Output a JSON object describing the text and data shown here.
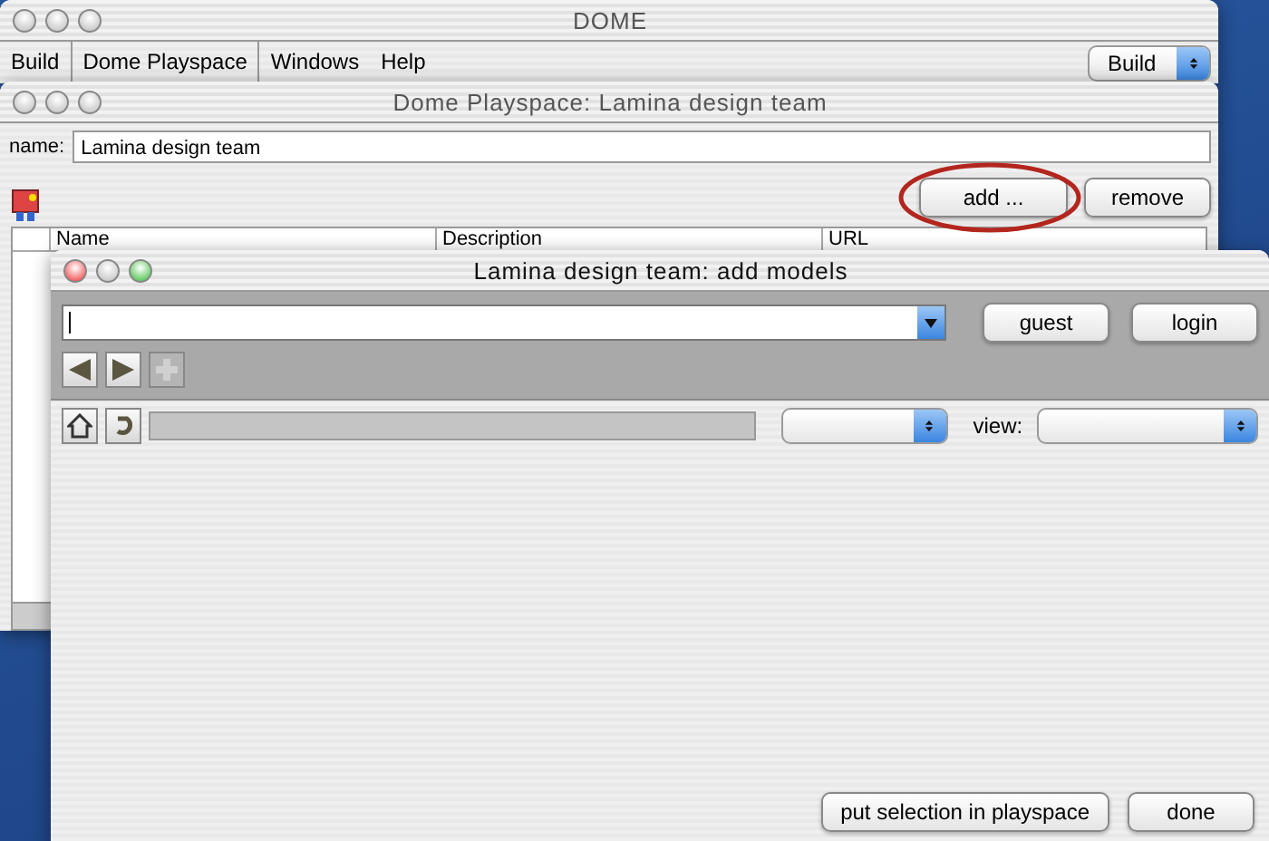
{
  "main_window": {
    "title": "DOME",
    "menu": [
      {
        "label": "Build",
        "separated": true
      },
      {
        "label": "Dome Playspace",
        "separated": true
      },
      {
        "label": "Windows",
        "separated": false
      },
      {
        "label": "Help",
        "separated": false
      }
    ],
    "mode_select": "Build"
  },
  "playspace_window": {
    "title": "Dome Playspace: Lamina design team",
    "name_label": "name:",
    "name_value": "Lamina design team",
    "buttons": [
      {
        "label": "add ...",
        "circled": true
      },
      {
        "label": "remove",
        "circled": false
      }
    ],
    "columns": [
      "Name",
      "Description",
      "URL"
    ]
  },
  "dialog": {
    "title": "Lamina design team: add models",
    "active": true,
    "top_buttons": [
      "guest",
      "login"
    ],
    "nav": [
      {
        "kind": "back",
        "disabled": false
      },
      {
        "kind": "forward",
        "disabled": false
      },
      {
        "kind": "add",
        "disabled": true
      }
    ],
    "progress": {
      "level": 0
    },
    "view_label": "view:",
    "bottom_buttons": [
      "put selection in playspace",
      "done"
    ]
  }
}
